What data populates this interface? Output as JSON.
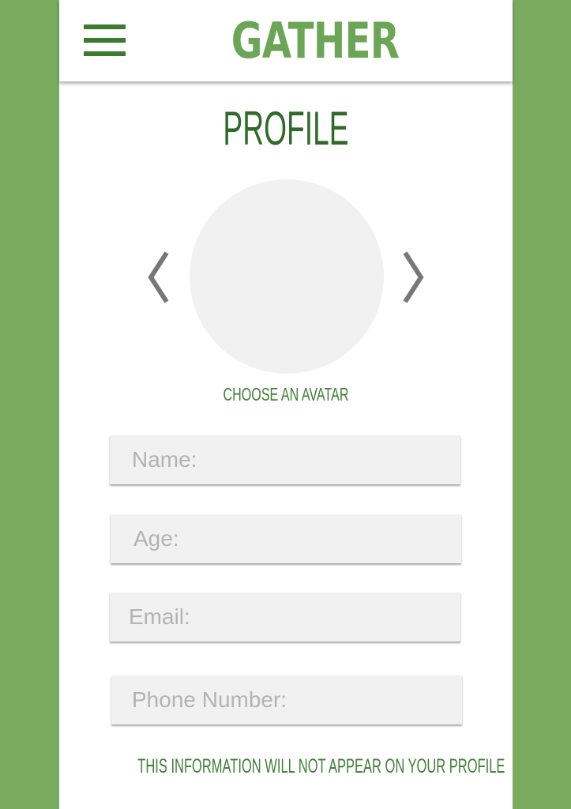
{
  "header": {
    "menu_icon": "hamburger-menu-icon",
    "app_name": "GATHER"
  },
  "page": {
    "title": "PROFILE"
  },
  "avatar": {
    "prev_icon": "chevron-left-icon",
    "next_icon": "chevron-right-icon",
    "caption": "CHOOSE AN AVATAR"
  },
  "form": {
    "name_placeholder": "Name:",
    "age_placeholder": "Age:",
    "email_placeholder": "Email:",
    "phone_placeholder": "Phone Number:",
    "name_value": "",
    "age_value": "",
    "email_value": "",
    "phone_value": ""
  },
  "notice": "THIS INFORMATION WILL NOT APPEAR ON YOUR PROFILE",
  "colors": {
    "background": "#79aa5e",
    "brand_green": "#6aa656",
    "dark_green": "#2f6a2a",
    "field_fill": "#f1f1f1",
    "arrow_gray": "#777777"
  }
}
